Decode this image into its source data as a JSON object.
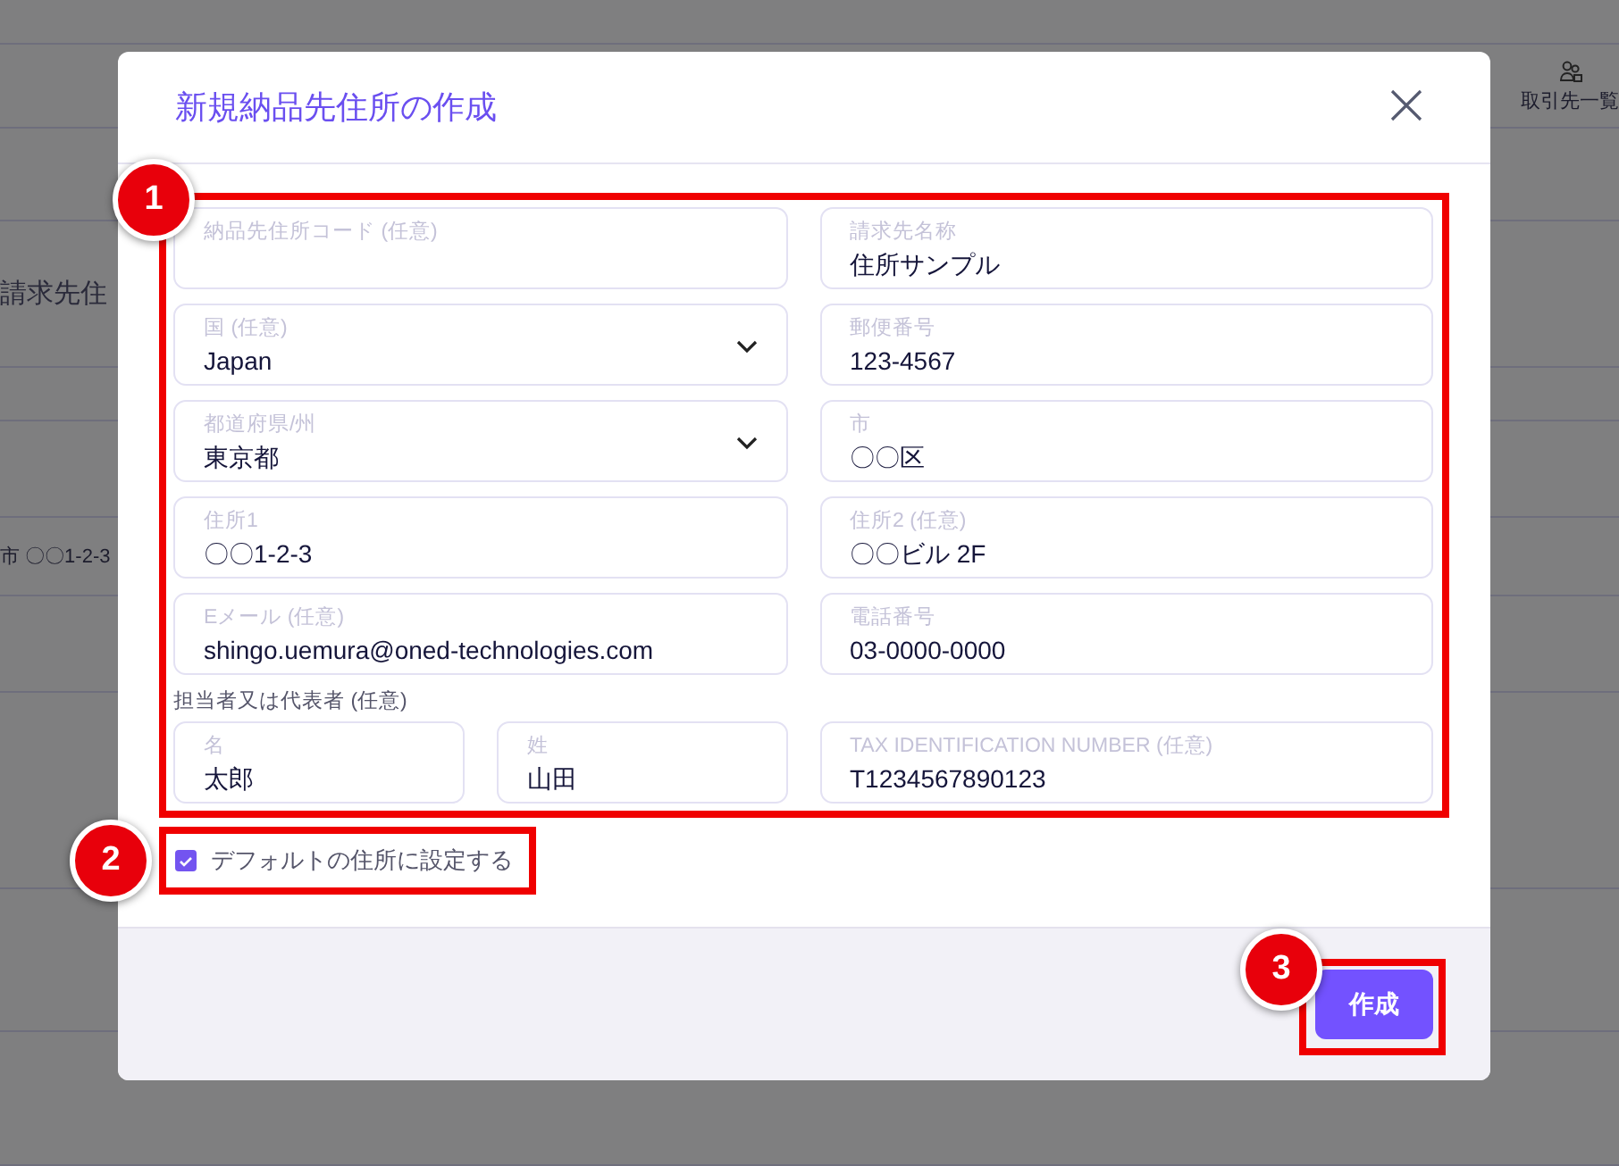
{
  "background": {
    "nav_link": "取引先一覧",
    "section_heading": "請求先住",
    "address_cell": "市 〇〇1-2-3"
  },
  "dialog": {
    "title": "新規納品先住所の作成",
    "fields": [
      {
        "kind": "text",
        "label": "納品先住所コード (任意)"
      },
      {
        "kind": "text",
        "label": "請求先名称",
        "value": "住所サンプル"
      },
      {
        "kind": "select",
        "label": "国 (任意)",
        "value": "Japan"
      },
      {
        "kind": "text",
        "label": "郵便番号",
        "value": "123-4567"
      },
      {
        "kind": "select",
        "label": "都道府県/州",
        "value": "東京都"
      },
      {
        "kind": "text",
        "label": "市",
        "value": "〇〇区"
      },
      {
        "kind": "text",
        "label": "住所1",
        "value": "〇〇1-2-3"
      },
      {
        "kind": "text",
        "label": "住所2 (任意)",
        "value": "〇〇ビル 2F"
      },
      {
        "kind": "text",
        "label": "Eメール (任意)",
        "value": "shingo.uemura@oned-technologies.com"
      },
      {
        "kind": "text",
        "label": "電話番号",
        "value": "03-0000-0000"
      }
    ],
    "contact_label": "担当者又は代表者 (任意)",
    "contact_fields": [
      {
        "kind": "text",
        "label": "名",
        "value": "太郎"
      },
      {
        "kind": "text",
        "label": "姓",
        "value": "山田"
      },
      {
        "kind": "text",
        "label": "TAX IDENTIFICATION NUMBER (任意)",
        "value": "T1234567890123"
      }
    ],
    "default_checkbox": {
      "label": "デフォルトの住所に設定する",
      "checked": true
    },
    "submit_button": "作成"
  },
  "annotations": [
    {
      "number": "1"
    },
    {
      "number": "2"
    },
    {
      "number": "3"
    }
  ]
}
